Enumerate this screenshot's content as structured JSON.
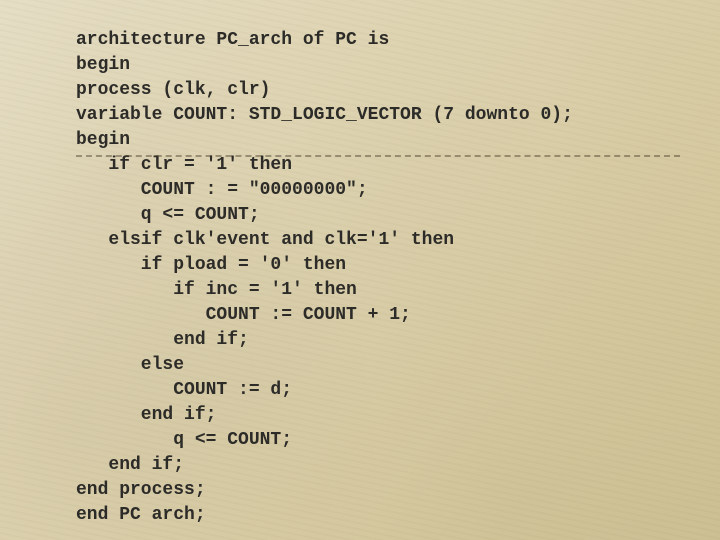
{
  "code": {
    "l1": "architecture PC_arch of PC is",
    "l2": "begin",
    "l3": "process (clk, clr)",
    "l4": "variable COUNT: STD_LOGIC_VECTOR (7 downto 0);",
    "l5": "begin",
    "l6": "   if clr = '1' then",
    "l7": "      COUNT : = \"00000000\";",
    "l8": "      q <= COUNT;",
    "l9": "   elsif clk'event and clk='1' then",
    "l10": "      if pload = '0' then",
    "l11": "         if inc = '1' then",
    "l12": "            COUNT := COUNT + 1;",
    "l13": "         end if;",
    "l14": "      else",
    "l15": "         COUNT := d;",
    "l16": "      end if;",
    "l17": "         q <= COUNT;",
    "l18": "   end if;",
    "l19": "end process;",
    "l20": "end PC arch;"
  }
}
